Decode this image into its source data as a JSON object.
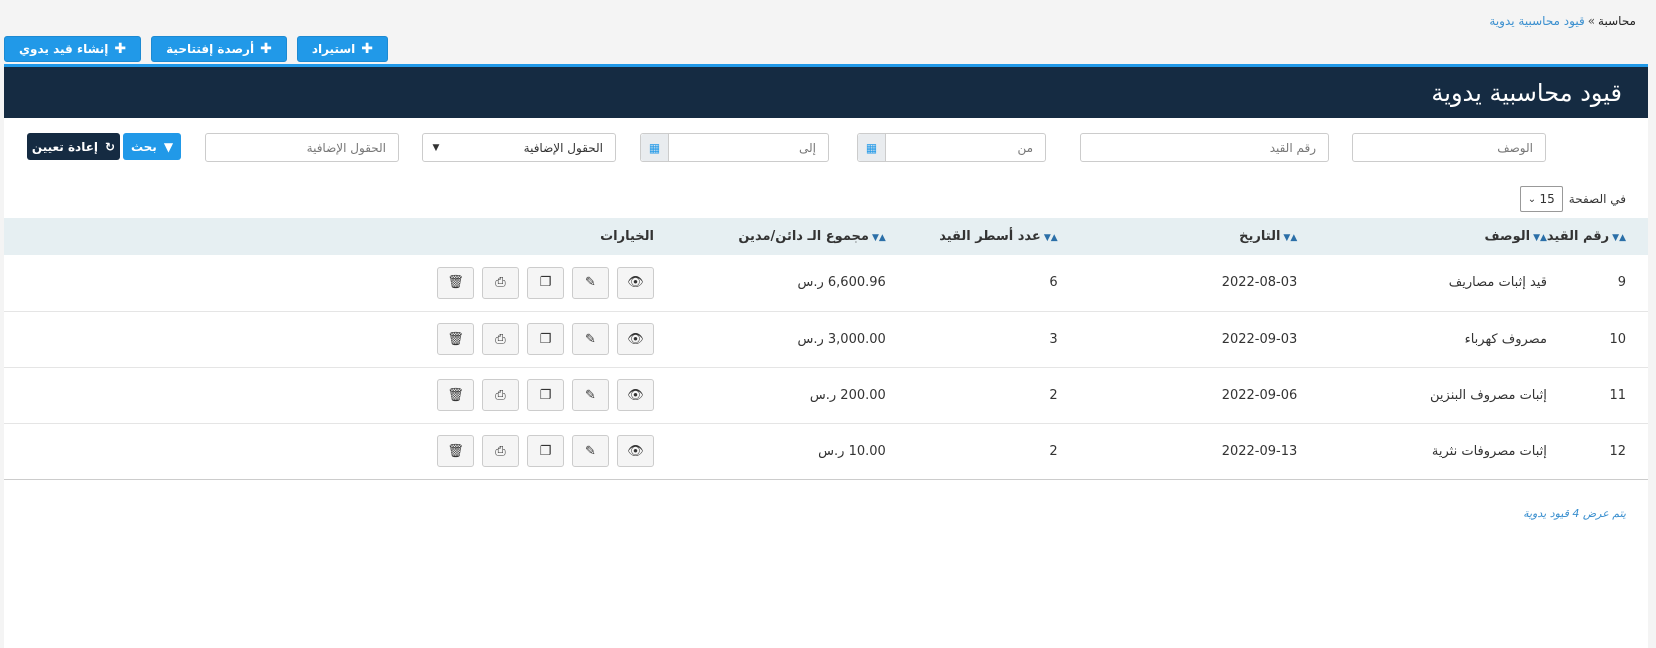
{
  "breadcrumb": {
    "root": "محاسبة",
    "separator": "»",
    "current": "قيود محاسبية يدوية"
  },
  "top_buttons": [
    {
      "label": "إنشاء قيد يدوي",
      "icon": "plus-icon"
    },
    {
      "label": "أرصدة إفتتاحية",
      "icon": "plus-icon"
    },
    {
      "label": "استيراد",
      "icon": "plus-icon"
    }
  ],
  "panel": {
    "title": "قيود محاسبية يدوية"
  },
  "filters": {
    "description_placeholder": "الوصف",
    "entry_no_placeholder": "رقم القيد",
    "from_placeholder": "من",
    "to_placeholder": "إلى",
    "extra_fields_select": "الحقول الإضافية",
    "extra_fields_placeholder": "الحقول الإضافية",
    "search_label": "بحث",
    "reset_label": "إعادة تعيين"
  },
  "per_page": {
    "label": "في الصفحة",
    "value": "15"
  },
  "table": {
    "headers": {
      "entry_no": "رقم القيد",
      "description": "الوصف",
      "date": "التاريخ",
      "lines": "عدد أسطر القيد",
      "total": "مجموع الـ دائن/مدين",
      "options": "الخيارات"
    },
    "rows": [
      {
        "entry_no": "9",
        "description": "قيد إثبات مصاريف",
        "date": "2022-08-03",
        "lines": "6",
        "total": "6,600.96 ر.س"
      },
      {
        "entry_no": "10",
        "description": "مصروف كهرباء",
        "date": "2022-09-03",
        "lines": "3",
        "total": "3,000.00 ر.س"
      },
      {
        "entry_no": "11",
        "description": "إثبات مصروف البنزين",
        "date": "2022-09-06",
        "lines": "2",
        "total": "200.00 ر.س"
      },
      {
        "entry_no": "12",
        "description": "إثبات مصروفات نثرية",
        "date": "2022-09-13",
        "lines": "2",
        "total": "10.00 ر.س"
      }
    ]
  },
  "summary": "يتم عرض 4 قيود يدوية",
  "colors": {
    "primary": "#2199e8",
    "header_bg": "#152b42",
    "table_head_bg": "#e6eff2",
    "dark_button": "#152b42"
  }
}
